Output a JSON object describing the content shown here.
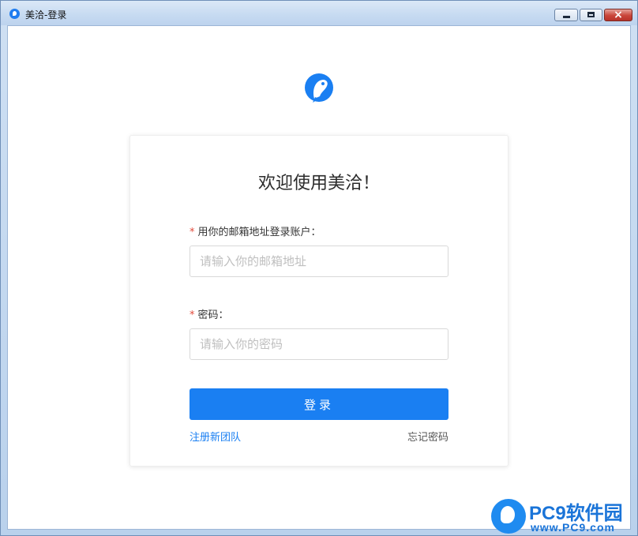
{
  "window": {
    "title": "美洽-登录",
    "close_glyph": "×"
  },
  "icons": {
    "app": "app-icon",
    "logo": "parrot-logo-icon",
    "accent_color": "#1a7ff2",
    "required_color": "#e24a3b"
  },
  "login": {
    "welcome": "欢迎使用美洽！",
    "required_mark": "*",
    "email_label": "用你的邮箱地址登录账户：",
    "email_placeholder": "请输入你的邮箱地址",
    "email_value": "",
    "password_label": "密码：",
    "password_placeholder": "请输入你的密码",
    "password_value": "",
    "submit_label": "登录",
    "register_link": "注册新团队",
    "forgot_link": "忘记密码"
  },
  "watermark": {
    "title": "PC9软件园",
    "url": "www.PC9.com"
  }
}
